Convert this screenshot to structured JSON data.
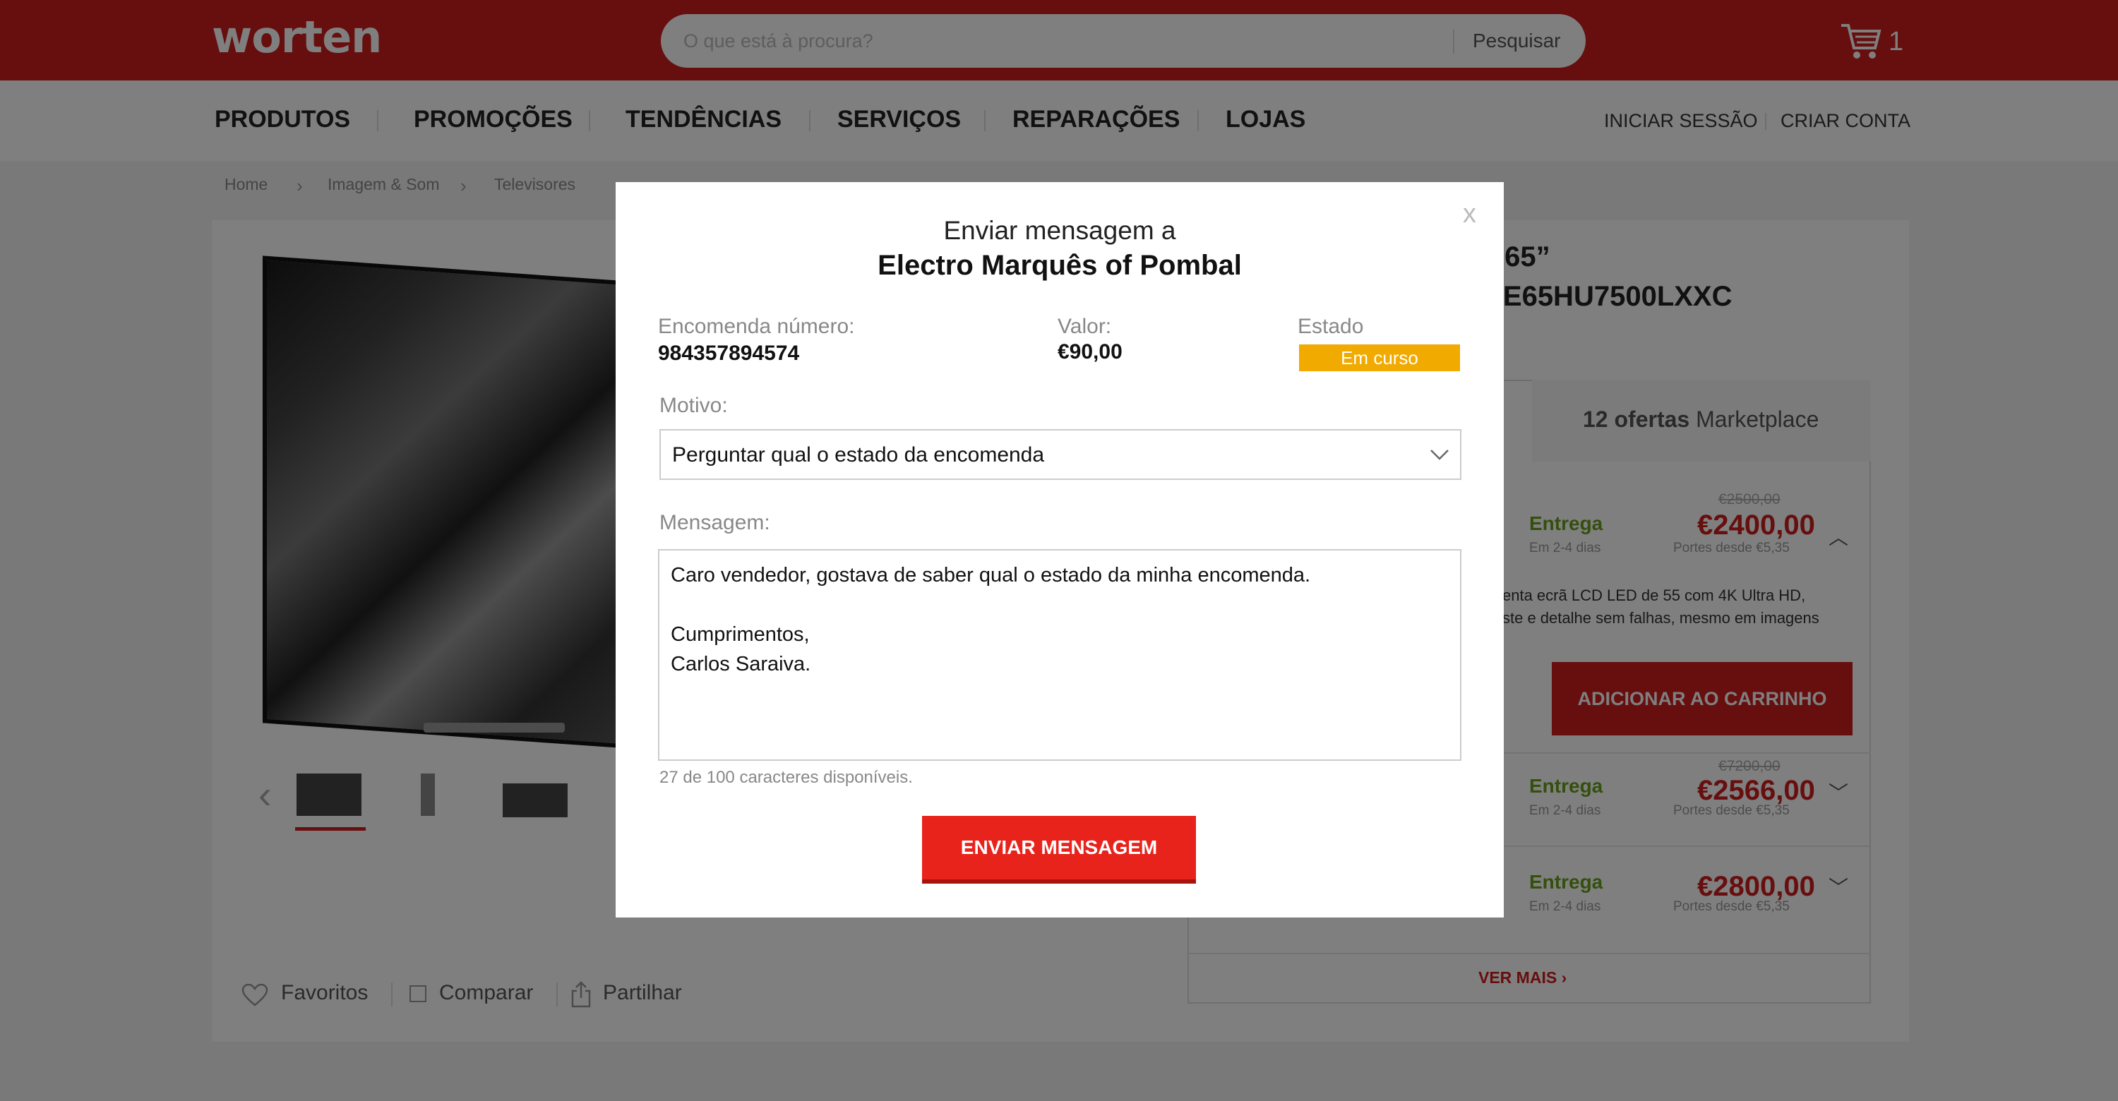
{
  "header": {
    "logo": "worten",
    "search_placeholder": "O que está à procura?",
    "search_button": "Pesquisar",
    "cart_count": "1"
  },
  "nav": {
    "items": [
      "PRODUTOS",
      "PROMOÇÕES",
      "TENDÊNCIAS",
      "SERVIÇOS",
      "REPARAÇÕES",
      "LOJAS"
    ],
    "login": "INICIAR SESSÃO",
    "register": "CRIAR CONTA"
  },
  "breadcrumb": [
    "Home",
    "Imagem & Som",
    "Televisores"
  ],
  "product": {
    "title_line1": "” 65”",
    "title_line2": "UE65HU7500LXXC",
    "description_line1": "enta ecrã LCD LED de 55 com 4K Ultra HD,",
    "description_line2": "ste e detalhe sem falhas, mesmo em imagens"
  },
  "offers": {
    "tab_count": "12 ofertas",
    "tab_label": "Marketplace",
    "rows": [
      {
        "entrega": "Entrega",
        "days": "Em 2-4 dias",
        "old_price": "€2500,00",
        "price": "€2400,00",
        "portes": "Portes desde €5,35"
      },
      {
        "entrega": "Entrega",
        "days": "Em 2-4 dias",
        "old_price": "€7200,00",
        "price": "€2566,00",
        "portes": "Portes desde €5,35"
      },
      {
        "entrega": "Entrega",
        "days": "Em 2-4 dias",
        "old_price": "",
        "price": "€2800,00",
        "portes": "Portes desde €5,35"
      }
    ],
    "add_to_cart": "ADICIONAR AO CARRINHO",
    "ver_mais": "VER MAIS"
  },
  "product_actions": {
    "favorite": "Favoritos",
    "compare": "Comparar",
    "share": "Partilhar"
  },
  "modal": {
    "title_line1": "Enviar mensagem a",
    "seller": "Electro Marquês of Pombal",
    "close": "x",
    "order_label": "Encomenda número:",
    "order_number": "984357894574",
    "value_label": "Valor:",
    "value": "€90,00",
    "status_label": "Estado",
    "status": "Em curso",
    "motive_label": "Motivo:",
    "motive_selected": "Perguntar qual o estado da encomenda",
    "message_label": "Mensagem:",
    "message": "Caro vendedor, gostava de saber qual o estado da minha encomenda.\n\nCumprimentos,\nCarlos Saraiva.",
    "counter": "27 de 100 caracteres disponíveis.",
    "send_button": "ENVIAR MENSAGEM"
  },
  "colors": {
    "brand_red": "#cf1d1d",
    "send_red": "#e8231c",
    "status_orange": "#f0aa00",
    "entrega_green": "#6a9e1f"
  }
}
